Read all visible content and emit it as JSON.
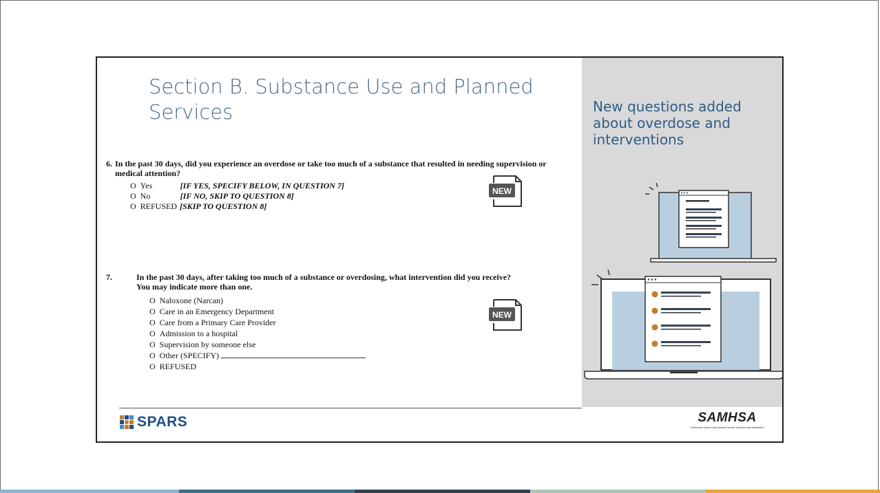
{
  "slide": {
    "title": "Section B. Substance Use and Planned Services",
    "side_text": "New questions added about overdose and interventions",
    "new_badge": "NEW"
  },
  "q6": {
    "number": "6.",
    "text": "In the past 30 days, did you experience an overdose or take too much of a substance that resulted in needing supervision or medical attention?",
    "options": [
      {
        "label": "Yes",
        "instruction": "[IF YES, SPECIFY BELOW, IN QUESTION 7]"
      },
      {
        "label": "No",
        "instruction": "[IF NO, SKIP TO QUESTION 8]"
      },
      {
        "label": "REFUSED",
        "instruction": "[SKIP TO QUESTION 8]"
      }
    ]
  },
  "q7": {
    "number": "7.",
    "text_line1": "In the past 30 days, after taking too much of a substance or overdosing, what intervention did you receive?",
    "text_line2": "You may indicate more than one.",
    "options": [
      "Naloxone (Narcan)",
      "Care in an Emergency Department",
      "Care from a Primary Care Provider",
      "Admission to a hospital",
      "Supervision by someone else",
      "Other (SPECIFY)",
      "REFUSED"
    ]
  },
  "footer": {
    "spars": "SPARS",
    "samhsa": "SAMHSA",
    "samhsa_sub": "Substance Abuse and Mental Health Services Administration"
  },
  "colors": {
    "title": "#4a6b82",
    "side_text": "#2f5c89",
    "side_panel": "#d9d9d9",
    "screen_fill": "#b9cfe0",
    "bullet": "#c87b2a",
    "spars_blue": "#1d4e89"
  }
}
